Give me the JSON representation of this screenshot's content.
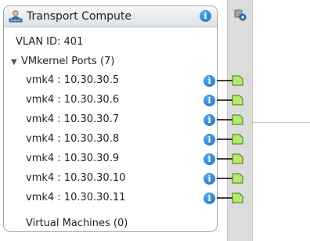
{
  "portgroup": {
    "title": "Transport Compute",
    "vlan": "VLAN ID: 401",
    "vmkernel_ports": {
      "label": "VMkernel Ports (7)",
      "items": [
        {
          "label": "vmk4 : 10.30.30.5"
        },
        {
          "label": "vmk4 : 10.30.30.6"
        },
        {
          "label": "vmk4 : 10.30.30.7"
        },
        {
          "label": "vmk4 : 10.30.30.8"
        },
        {
          "label": "vmk4 : 10.30.30.9"
        },
        {
          "label": "vmk4 : 10.30.30.10"
        },
        {
          "label": "vmk4 : 10.30.30.11"
        }
      ]
    },
    "virtual_machines": "Virtual Machines (0)"
  },
  "icons": {
    "portgroup": "network-portgroup-icon",
    "info": "info-icon",
    "port": "port-connector-icon",
    "strip": "vswitch-settings-icon"
  },
  "colors": {
    "info_blue": "#1c6fc0",
    "port_green": "#b6e86c",
    "card_border": "#9aa4ad"
  }
}
